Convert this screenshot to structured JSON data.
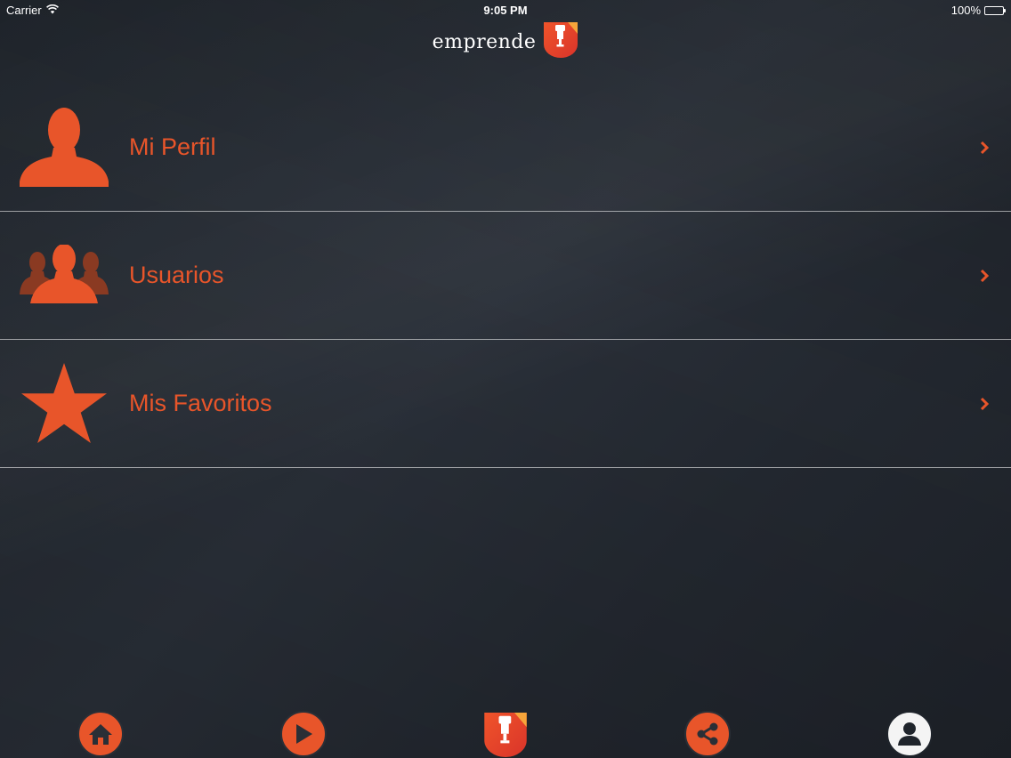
{
  "status_bar": {
    "carrier": "Carrier",
    "time": "9:05 PM",
    "battery": "100%"
  },
  "header": {
    "brand": "emprende"
  },
  "menu": {
    "items": [
      {
        "label": "Mi Perfil",
        "icon": "user-icon"
      },
      {
        "label": "Usuarios",
        "icon": "users-icon"
      },
      {
        "label": "Mis Favoritos",
        "icon": "star-icon"
      }
    ]
  },
  "tab_bar": {
    "items": [
      {
        "icon": "home-icon"
      },
      {
        "icon": "play-icon"
      },
      {
        "icon": "emprende-logo-icon"
      },
      {
        "icon": "share-icon"
      },
      {
        "icon": "profile-icon",
        "selected": true
      }
    ]
  },
  "colors": {
    "accent": "#e8552a",
    "accent_dark": "#8a3a22",
    "background": "#252a32",
    "divider": "#bfc2c6"
  }
}
